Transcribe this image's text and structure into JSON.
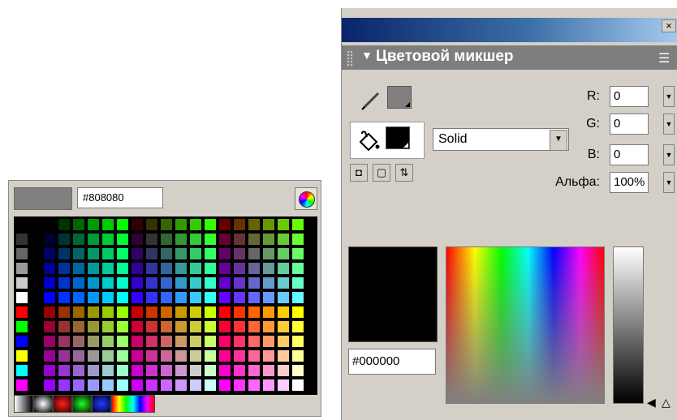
{
  "swatches": {
    "current_hex": "#808080",
    "current_color": "#808080",
    "gradients": [
      "linear-gray",
      "radial-gray",
      "red-radial",
      "green-radial",
      "blue-radial",
      "rainbow"
    ]
  },
  "mixer": {
    "close_label": "×",
    "title": "Цветовой микшер",
    "fill_type": "Solid",
    "r_label": "R:",
    "g_label": "G:",
    "b_label": "B:",
    "alpha_label": "Альфа:",
    "r_value": "0",
    "g_value": "0",
    "b_value": "0",
    "alpha_value": "100%",
    "hex_value": "#000000",
    "stroke_color": "#808080",
    "fill_color": "#000000",
    "icons": [
      "pencil-icon",
      "paint-bucket-icon",
      "swap-colors-icon",
      "no-color-icon",
      "reset-colors-icon",
      "color-wheel-icon",
      "options-menu-icon"
    ]
  }
}
